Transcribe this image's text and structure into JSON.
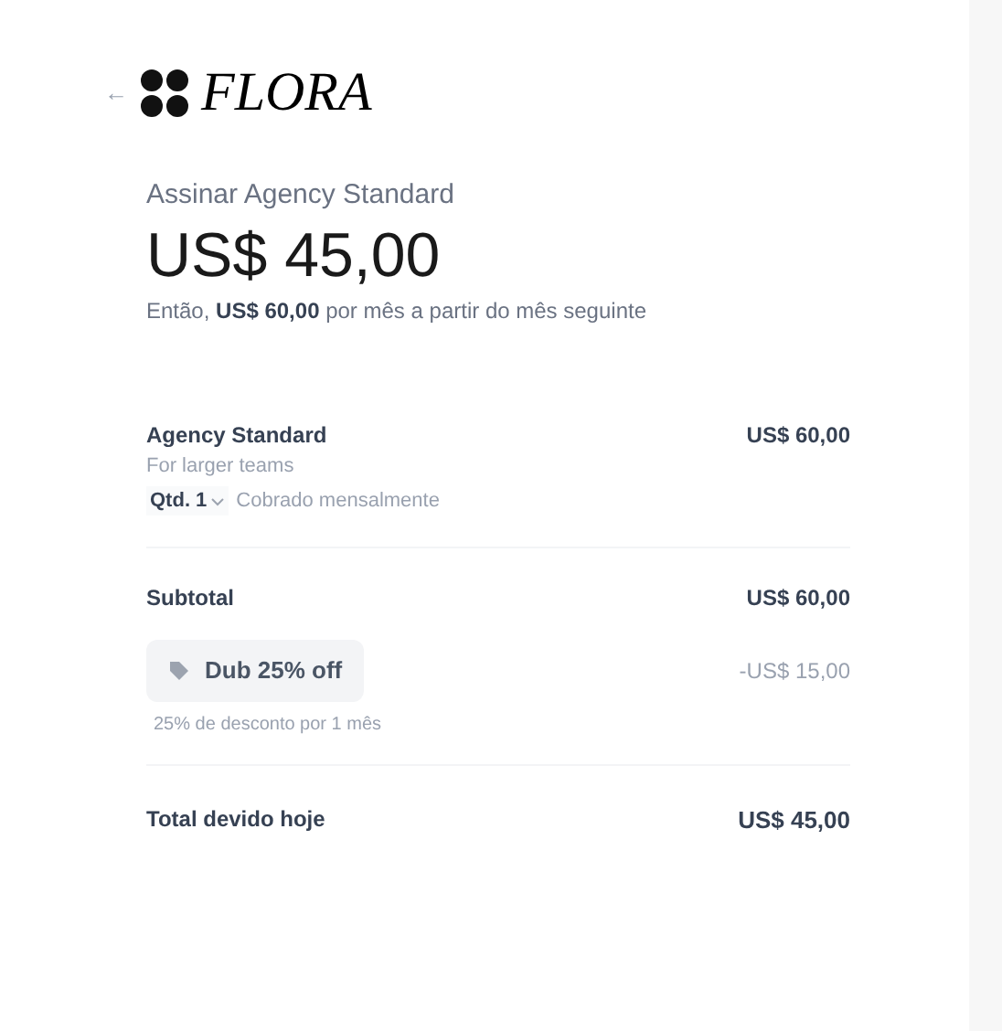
{
  "header": {
    "back": "←",
    "logo": "FLORA"
  },
  "summary": {
    "title": "Assinar Agency Standard",
    "price": "US$ 45,00",
    "note": "Então, **US$ 60,00** por mês a partir do mês seguinte"
  },
  "item": {
    "name": "Agency Standard",
    "description": "For larger teams",
    "quantity": "Qtd. 1",
    "billing": "Cobrado mensalmente",
    "price": "US$ 60,00"
  },
  "subtotal": {
    "label": "Subtotal",
    "value": "US$ 60,00"
  },
  "discount": {
    "code": "Dub 25% off",
    "value": "-US$ 15,00",
    "note": "25% de desconto por 1 mês"
  },
  "total": {
    "label": "Total devido hoje",
    "value": "US$ 45,00"
  }
}
